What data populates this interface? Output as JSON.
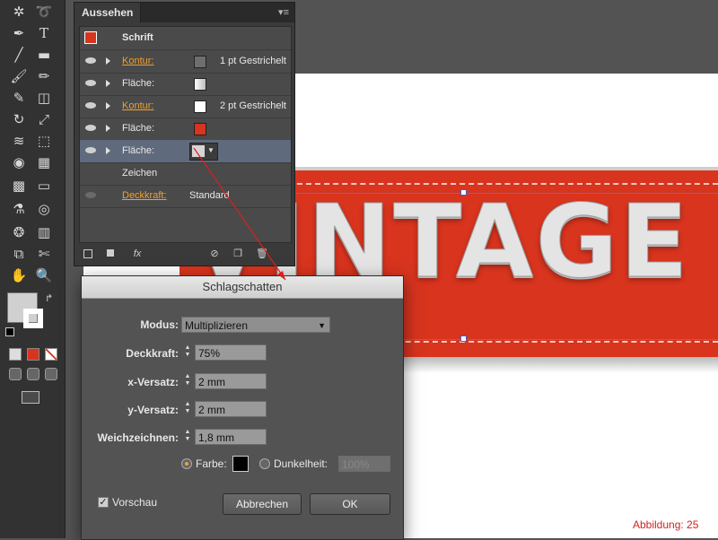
{
  "appearance_panel": {
    "tab_title": "Aussehen",
    "menu_icon": "panel-menu-icon",
    "object_label": "Schrift",
    "rows": [
      {
        "label": "Kontur:",
        "link": true,
        "swatch": "#6e6e6e",
        "value": "1 pt Gestrichelt"
      },
      {
        "label": "Fläche:",
        "link": false,
        "swatch": "gradient-white-gray",
        "value": ""
      },
      {
        "label": "Kontur:",
        "link": true,
        "swatch": "#ffffff",
        "value": "2 pt Gestrichelt"
      },
      {
        "label": "Fläche:",
        "link": false,
        "swatch": "#d8341e",
        "value": ""
      },
      {
        "label": "Fläche:",
        "link": false,
        "swatch": "#d6d6d6",
        "value": "",
        "selected": true
      }
    ],
    "characters_label": "Zeichen",
    "opacity_label": "Deckkraft:",
    "opacity_value": "Standard",
    "footer_fx": "fx"
  },
  "artboard": {
    "banner_text": "VINTAGE",
    "banner_color": "#d8341e"
  },
  "dialog": {
    "title": "Schlagschatten",
    "mode_label": "Modus:",
    "mode_value": "Multiplizieren",
    "opacity_label": "Deckkraft:",
    "opacity_value": "75%",
    "x_label": "x-Versatz:",
    "x_value": "2 mm",
    "y_label": "y-Versatz:",
    "y_value": "2 mm",
    "blur_label": "Weichzeichnen:",
    "blur_value": "1,8 mm",
    "color_label": "Farbe:",
    "color_value": "#000000",
    "darkness_label": "Dunkelheit:",
    "darkness_value": "100%",
    "preview_label": "Vorschau",
    "preview_checked": true,
    "cancel_label": "Abbrechen",
    "ok_label": "OK"
  },
  "toolbar": {
    "tools": [
      "magic-wand-icon",
      "lasso-icon",
      "pen-icon",
      "type-icon",
      "line-icon",
      "rectangle-icon",
      "brush-icon",
      "pencil-icon",
      "blob-brush-icon",
      "eraser-icon",
      "rotate-icon",
      "scale-icon",
      "warp-icon",
      "free-transform-icon",
      "shape-builder-icon",
      "perspective-icon",
      "mesh-icon",
      "gradient-icon",
      "eyedropper-icon",
      "blend-icon",
      "symbol-sprayer-icon",
      "graph-icon",
      "artboard-icon",
      "slice-icon",
      "hand-icon",
      "zoom-icon"
    ]
  },
  "figure_caption": "Abbildung: 25"
}
